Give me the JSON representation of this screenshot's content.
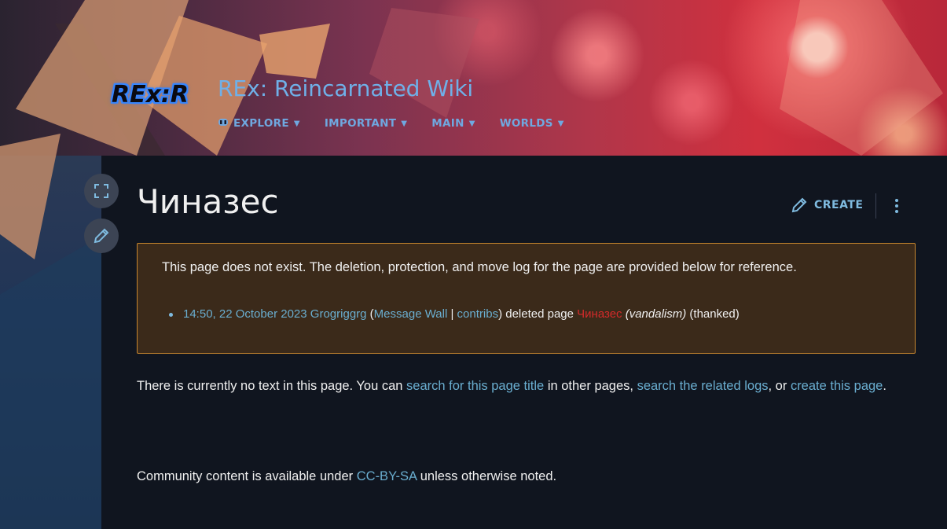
{
  "header": {
    "logo_text": "REx:R",
    "wiki_title": "REx: Reincarnated Wiki",
    "nav": [
      {
        "label": "EXPLORE"
      },
      {
        "label": "IMPORTANT"
      },
      {
        "label": "MAIN"
      },
      {
        "label": "WORLDS"
      }
    ]
  },
  "side_tools": {
    "fullscreen_icon": "expand-icon",
    "edit_icon": "pencil-icon"
  },
  "page": {
    "title": "Чиназес",
    "create_label": "CREATE"
  },
  "notice": {
    "text": "This page does not exist. The deletion, protection, and move log for the page are provided below for reference.",
    "log": {
      "timestamp": "14:50, 22 October 2023",
      "user": "Grogriggrg",
      "open_paren": " (",
      "message_wall": "Message Wall",
      "separator": " | ",
      "contribs": "contribs",
      "action": ") deleted page ",
      "page": "Чиназес",
      "reason": " (vandalism)",
      "thanked": " (thanked)"
    }
  },
  "body": {
    "p1": "There is currently no text in this page. You can ",
    "link_search_title": "search for this page title",
    "p2": " in other pages, ",
    "link_related_logs": "search the related logs",
    "p3": ", or ",
    "link_create": "create this page",
    "p4": "."
  },
  "footer": {
    "prefix": "Community content is available under ",
    "license": "CC-BY-SA",
    "suffix": " unless otherwise noted."
  },
  "colors": {
    "link": "#6aaed0",
    "red_link": "#d42a2a",
    "notice_bg": "#3b2a1a",
    "notice_border": "#c8872e",
    "content_bg": "#10151f"
  }
}
